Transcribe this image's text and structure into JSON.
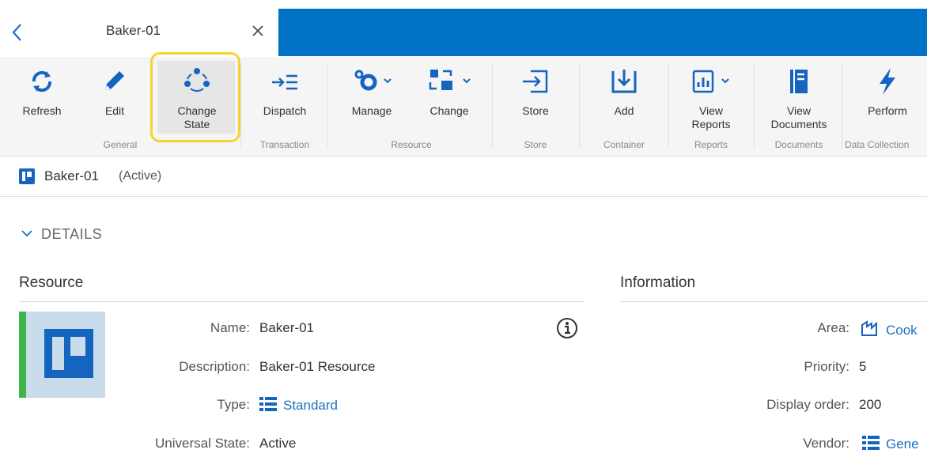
{
  "tab": {
    "title": "Baker-01"
  },
  "ribbon": {
    "buttons": [
      {
        "label": "Refresh"
      },
      {
        "label": "Edit"
      },
      {
        "label": "Change\nState"
      },
      {
        "label": "Dispatch"
      },
      {
        "label": "Manage"
      },
      {
        "label": "Change"
      },
      {
        "label": "Store"
      },
      {
        "label": "Add"
      },
      {
        "label": "View\nReports"
      },
      {
        "label": "View\nDocuments"
      },
      {
        "label": "Perform"
      }
    ],
    "groups": [
      "General",
      "Transaction",
      "Resource",
      "Store",
      "Container",
      "Reports",
      "Documents",
      "Data Collection"
    ]
  },
  "breadcrumb": {
    "name": "Baker-01",
    "state": "(Active)"
  },
  "details": {
    "heading": "DETAILS",
    "resource": {
      "title": "Resource",
      "fields": [
        {
          "label": "Name:",
          "value": "Baker-01"
        },
        {
          "label": "Description:",
          "value": "Baker-01 Resource"
        },
        {
          "label": "Type:",
          "value": "Standard"
        },
        {
          "label": "Universal State:",
          "value": "Active"
        }
      ]
    },
    "information": {
      "title": "Information",
      "fields": [
        {
          "label": "Area:",
          "value": "Cook"
        },
        {
          "label": "Priority:",
          "value": "5"
        },
        {
          "label": "Display order:",
          "value": "200"
        },
        {
          "label": "Vendor:",
          "value": "Gene"
        }
      ]
    }
  },
  "colors": {
    "accent": "#0073c6",
    "link": "#1e6fc0",
    "highlight": "#f5d430",
    "status_bar": "#3db54a"
  }
}
